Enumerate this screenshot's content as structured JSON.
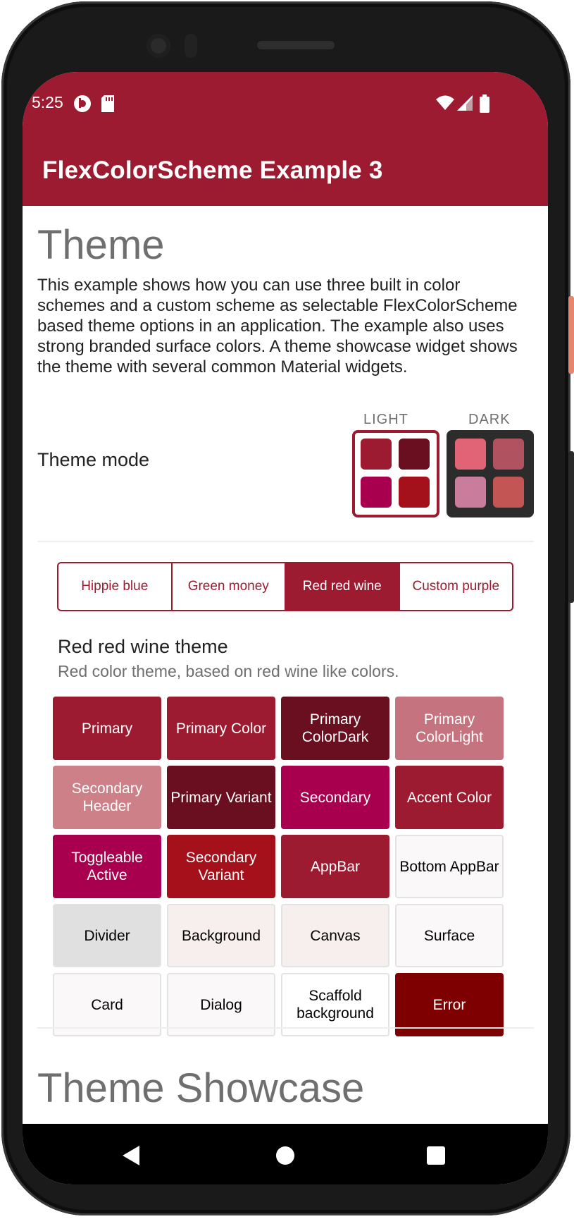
{
  "status": {
    "time": "5:25"
  },
  "appbar": {
    "title": "FlexColorScheme Example 3"
  },
  "intro": {
    "heading": "Theme",
    "description": "This example shows how you can use three built in color schemes and a custom scheme as selectable FlexColorScheme based theme options in an application. The example also uses strong branded surface colors. A theme showcase widget shows the theme with several common Material widgets."
  },
  "theme_mode": {
    "label": "Theme mode",
    "light_label": "LIGHT",
    "dark_label": "DARK",
    "light_colors": [
      "#9c1b30",
      "#6a0f1f",
      "#a8004e",
      "#a4111b"
    ],
    "dark_colors": [
      "#e06376",
      "#b0525f",
      "#c97c9c",
      "#c45555"
    ]
  },
  "schemes": {
    "options": [
      "Hippie blue",
      "Green money",
      "Red red wine",
      "Custom purple"
    ],
    "selected": "Red red wine"
  },
  "scheme_info": {
    "name": "Red red wine theme",
    "description": "Red color theme, based on red wine like colors."
  },
  "colors": [
    {
      "label": "Primary",
      "bg": "#9c1b30",
      "fg": "#ffffff"
    },
    {
      "label": "Primary Color",
      "bg": "#9c1b30",
      "fg": "#ffffff"
    },
    {
      "label": "Primary ColorDark",
      "bg": "#6a0f1f",
      "fg": "#ffffff"
    },
    {
      "label": "Primary ColorLight",
      "bg": "#c4737f",
      "fg": "#ffffff"
    },
    {
      "label": "Secondary Header",
      "bg": "#cd8088",
      "fg": "#ffffff"
    },
    {
      "label": "Primary Variant",
      "bg": "#6a0f1f",
      "fg": "#ffffff"
    },
    {
      "label": "Secondary",
      "bg": "#a8004e",
      "fg": "#ffffff"
    },
    {
      "label": "Accent Color",
      "bg": "#9c1b30",
      "fg": "#ffffff"
    },
    {
      "label": "Toggleable Active",
      "bg": "#a8004e",
      "fg": "#ffffff"
    },
    {
      "label": "Secondary Variant",
      "bg": "#a4111b",
      "fg": "#ffffff"
    },
    {
      "label": "AppBar",
      "bg": "#9c1b30",
      "fg": "#ffffff"
    },
    {
      "label": "Bottom AppBar",
      "bg": "#faf8f8",
      "fg": "#000000"
    },
    {
      "label": "Divider",
      "bg": "#e0e0e0",
      "fg": "#000000"
    },
    {
      "label": "Background",
      "bg": "#f7eeee",
      "fg": "#000000"
    },
    {
      "label": "Canvas",
      "bg": "#f7eeee",
      "fg": "#000000"
    },
    {
      "label": "Surface",
      "bg": "#faf8f8",
      "fg": "#000000"
    },
    {
      "label": "Card",
      "bg": "#faf8f8",
      "fg": "#000000"
    },
    {
      "label": "Dialog",
      "bg": "#faf8f8",
      "fg": "#000000"
    },
    {
      "label": "Scaffold background",
      "bg": "#ffffff",
      "fg": "#000000"
    },
    {
      "label": "Error",
      "bg": "#7f0000",
      "fg": "#ffffff"
    }
  ],
  "showcase": {
    "heading": "Theme Showcase"
  },
  "icons": {
    "status_left": [
      "notification-icon",
      "sd-card-icon"
    ],
    "status_right": [
      "wifi-icon",
      "signal-icon",
      "battery-icon"
    ],
    "nav": [
      "back-icon",
      "home-icon",
      "recents-icon"
    ]
  }
}
